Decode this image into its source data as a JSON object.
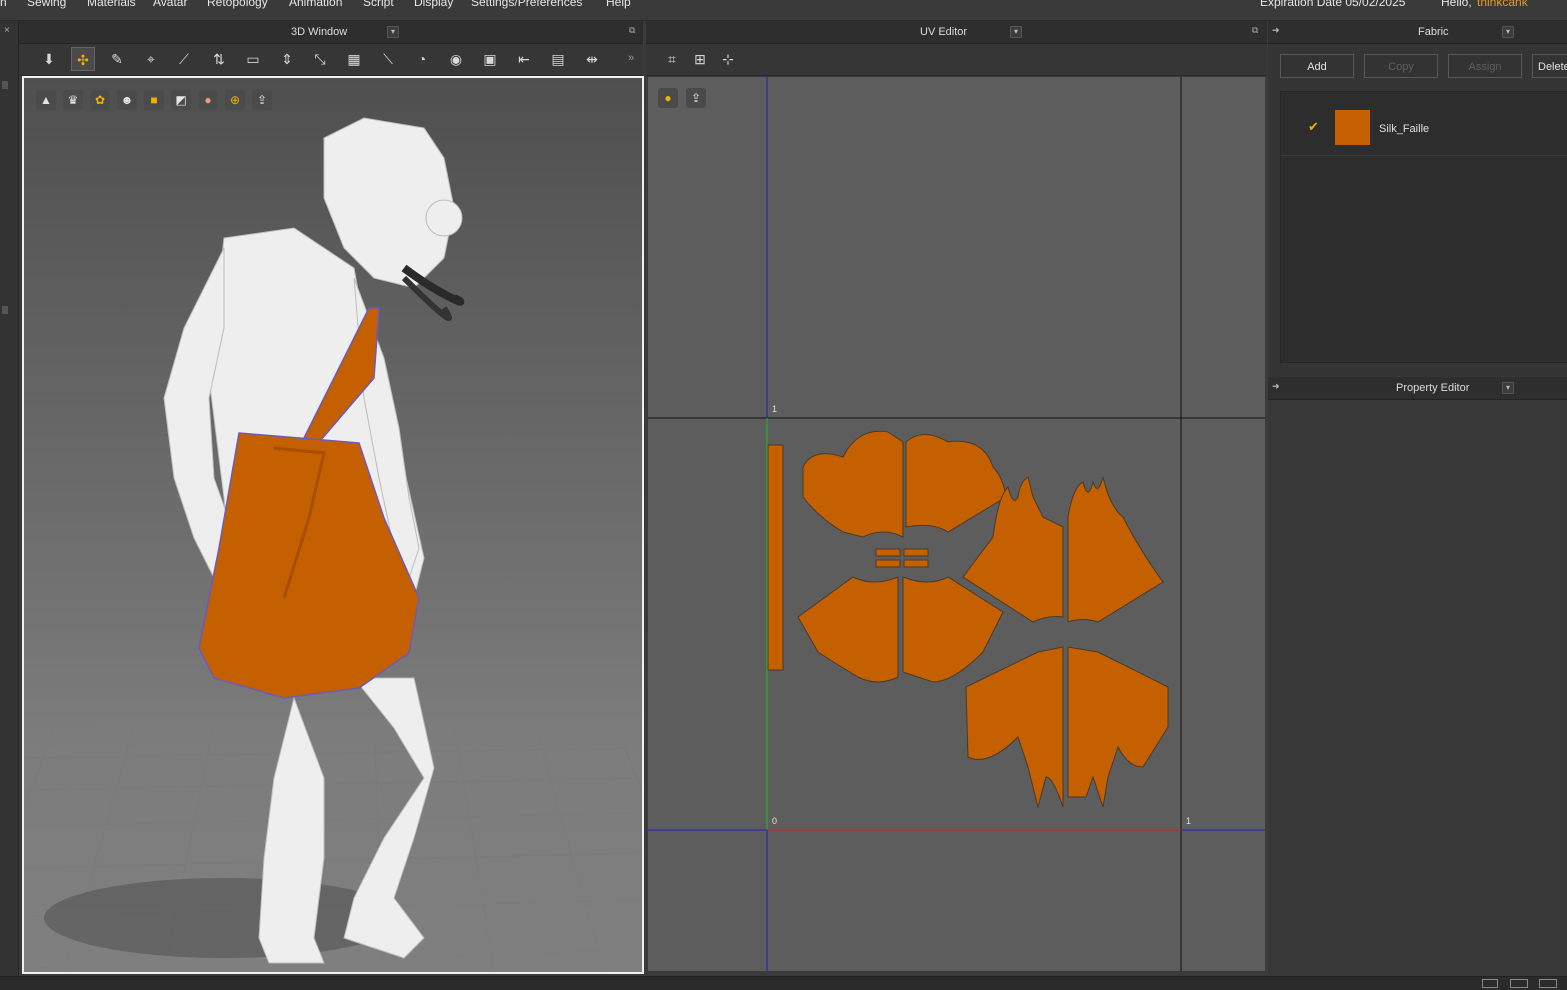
{
  "menu": {
    "items": [
      "n",
      "Sewing",
      "Materials",
      "Avatar",
      "Retopology",
      "Animation",
      "Script",
      "Display",
      "Settings/Preferences",
      "Help"
    ],
    "expiration": "Expiration Date 05/02/2025",
    "hello": "Hello,",
    "username": "thinkcank"
  },
  "window3d": {
    "title": "3D Window"
  },
  "uv": {
    "title": "UV Editor",
    "axis_top": "1",
    "axis_origin": "0",
    "axis_right": "1"
  },
  "fabric": {
    "title": "Fabric",
    "buttons": {
      "add": "Add",
      "copy": "Copy",
      "assign": "Assign",
      "delete": "Delete"
    },
    "items": [
      {
        "name": "Silk_Faille",
        "color": "#c46000",
        "checked": true
      }
    ]
  },
  "property_editor": {
    "title": "Property Editor"
  },
  "colors": {
    "accent": "#f0b000",
    "fabric": "#c46000",
    "viewport_top": "#555555",
    "viewport_bottom": "#8a8a8a",
    "uv_bg": "#5c5c5c"
  },
  "icons": {
    "toolbar3d": [
      "arrow-down-icon",
      "move-icon",
      "edit-pattern-icon",
      "tack-icon",
      "pin-icon",
      "fold-icon",
      "camera-icon",
      "gizmo-icon",
      "transform-icon",
      "texture-icon",
      "brush-icon",
      "measure-icon",
      "record-icon",
      "cloth-icon",
      "tape-icon",
      "segment-icon",
      "steam-icon"
    ],
    "viewport3d": [
      "avatar-display-icon",
      "garment-display-icon",
      "texture-display-icon",
      "avatar-icon",
      "fabric-display-icon",
      "mesh-icon",
      "skin-icon",
      "sphere-icon",
      "export-icon"
    ],
    "uvtools": [
      "uv-snapshot-icon",
      "uv-unfold-icon",
      "uv-pack-icon"
    ]
  }
}
